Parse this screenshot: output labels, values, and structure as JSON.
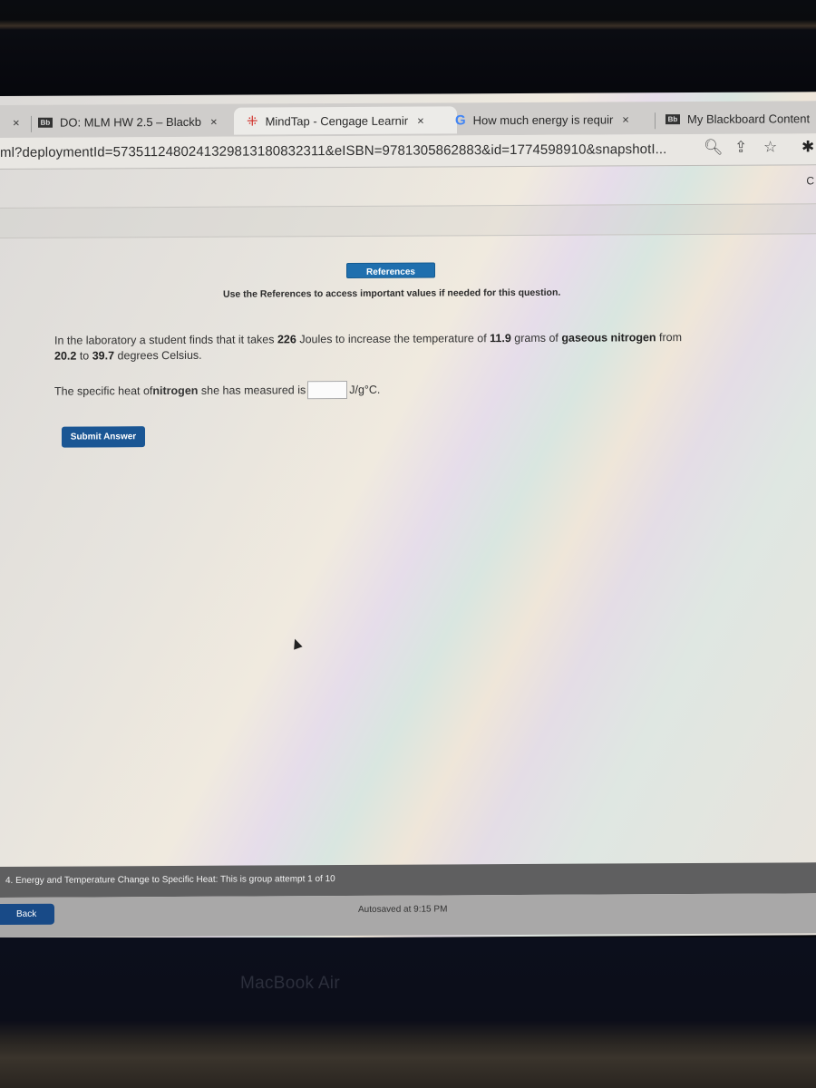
{
  "browser": {
    "tabs": [
      {
        "label": "DO: MLM HW 2.5 – Blackb",
        "icon": "blackboard-icon",
        "close": "×",
        "active": false
      },
      {
        "label": "MindTap - Cengage Learnir",
        "icon": "mindtap-icon",
        "close": "×",
        "active": true
      },
      {
        "label": "How much energy is requir",
        "icon": "google-icon",
        "close": "×",
        "active": false
      },
      {
        "label": "My Blackboard Content",
        "icon": "blackboard-icon",
        "active": false
      }
    ],
    "leftmost_close": "×",
    "bb_icon_text": "Bb",
    "google_icon_text": "G",
    "mindtap_icon_text": "⁜",
    "url": "ml?deploymentId=5735112480241329813180832311&eISBN=9781305862883&id=1774598910&snapshotI...",
    "icons": {
      "zoom": "🔍︎",
      "share": "⇪",
      "bookmark": "☆",
      "extensions": "✱",
      "reload": "C"
    }
  },
  "question": {
    "references_button": "References",
    "references_note": "Use the References to access important values if needed for this question.",
    "problem": {
      "part1": "In the laboratory a student finds that it takes ",
      "energy_joules": "226",
      "part2": " Joules to increase the temperature of ",
      "mass_grams": "11.9",
      "part3": " grams of ",
      "substance": "gaseous nitrogen",
      "part4": " from ",
      "temp_start": "20.2",
      "part5": " to ",
      "temp_end": "39.7",
      "part6": " degrees Celsius."
    },
    "answer_prompt_part1": "The specific heat of ",
    "answer_substance": "nitrogen",
    "answer_prompt_part2": " she has measured is",
    "answer_value": "",
    "answer_unit": "J/g°C.",
    "submit_label": "Submit Answer"
  },
  "footer": {
    "status": "4. Energy and Temperature Change to Specific Heat: This is group attempt 1 of 10",
    "back_label": "Back",
    "autosave": "Autosaved at 9:15 PM"
  },
  "device": {
    "brand": "MacBook Air"
  }
}
